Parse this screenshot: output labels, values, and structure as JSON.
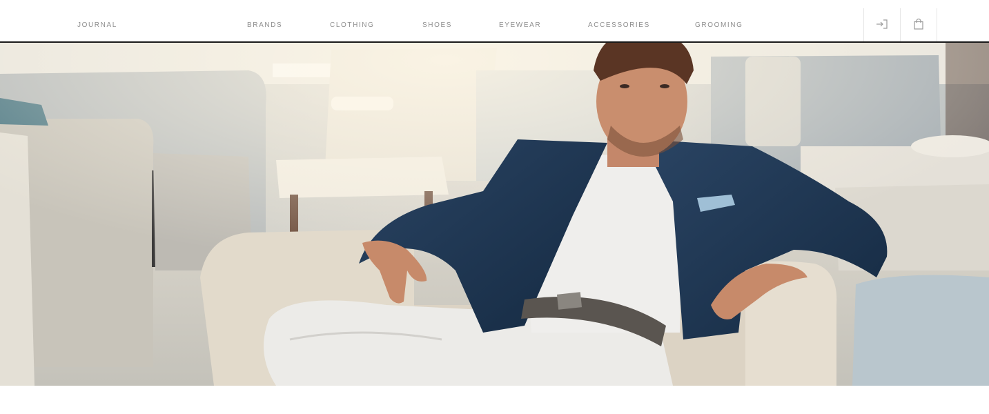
{
  "header": {
    "nav": [
      {
        "id": "journal",
        "label": "JOURNAL"
      },
      {
        "id": "brands",
        "label": "BRANDS"
      },
      {
        "id": "clothing",
        "label": "CLOTHING"
      },
      {
        "id": "shoes",
        "label": "SHOES"
      },
      {
        "id": "eyewear",
        "label": "EYEWEAR"
      },
      {
        "id": "accessories",
        "label": "ACCESSORIES"
      },
      {
        "id": "grooming",
        "label": "GROOMING"
      }
    ],
    "icons": {
      "login": "sign-in-icon",
      "cart": "shopping-bag-icon"
    }
  },
  "colors": {
    "nav_text": "#8e8e8e",
    "header_border": "#1a1a1a",
    "jacket": "#1e3450",
    "lounge_furniture": "#d9d3c8"
  }
}
